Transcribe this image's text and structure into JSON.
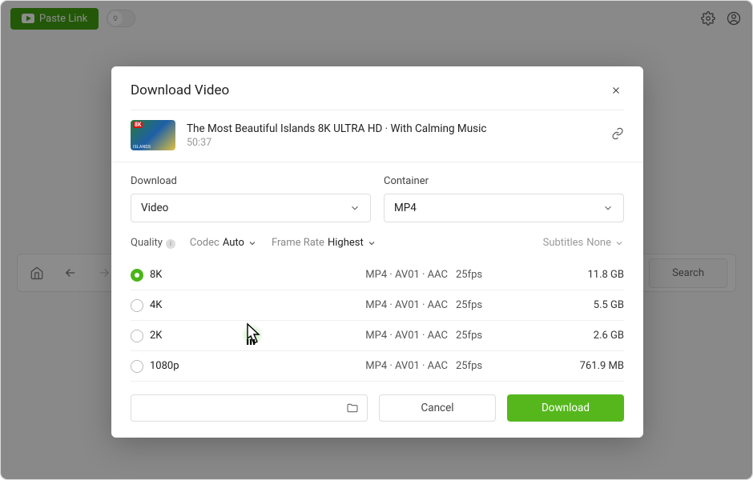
{
  "header": {
    "paste_label": "Paste Link"
  },
  "toolbar": {
    "search_label": "Search"
  },
  "modal": {
    "title": "Download Video",
    "video": {
      "title": "The Most Beautiful Islands 8K ULTRA HD · With Calming Music",
      "duration": "50:37"
    },
    "download_label": "Download",
    "container_label": "Container",
    "download_value": "Video",
    "container_value": "MP4",
    "filters": {
      "quality_label": "Quality",
      "codec_label": "Codec",
      "codec_value": "Auto",
      "fps_label": "Frame Rate",
      "fps_value": "Highest",
      "subtitles_label": "Subtitles",
      "subtitles_value": "None"
    },
    "qualities": [
      {
        "label": "8K",
        "codec": "MP4 · AV01 · AAC",
        "fps": "25fps",
        "size": "11.8 GB",
        "selected": true
      },
      {
        "label": "4K",
        "codec": "MP4 · AV01 · AAC",
        "fps": "25fps",
        "size": "5.5 GB",
        "selected": false
      },
      {
        "label": "2K",
        "codec": "MP4 · AV01 · AAC",
        "fps": "25fps",
        "size": "2.6 GB",
        "selected": false
      },
      {
        "label": "1080p",
        "codec": "MP4 · AV01 · AAC",
        "fps": "25fps",
        "size": "761.9 MB",
        "selected": false
      }
    ],
    "cancel_label": "Cancel",
    "confirm_label": "Download"
  }
}
